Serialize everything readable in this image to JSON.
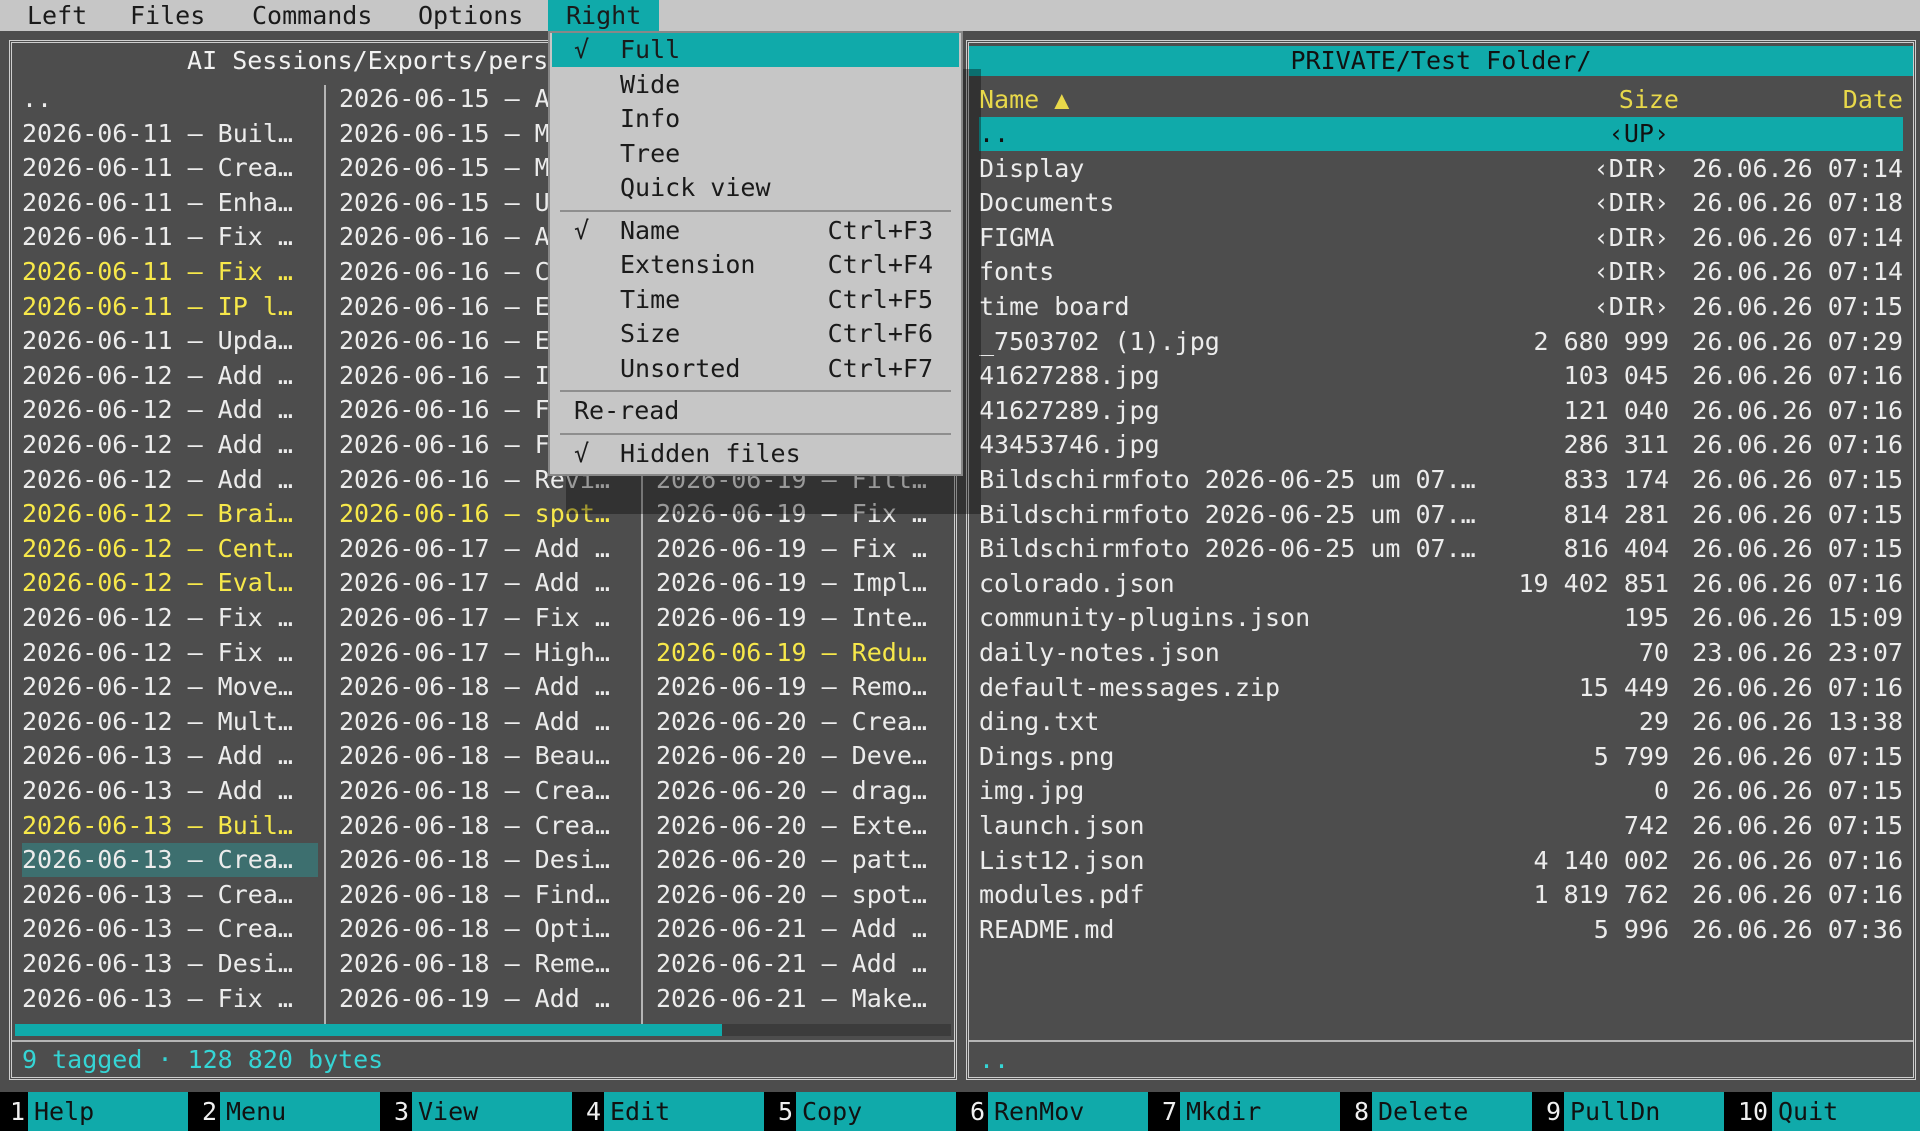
{
  "menubar": {
    "items": [
      "Left",
      "Files",
      "Commands",
      "Options",
      "Right"
    ],
    "active": "Right"
  },
  "left_panel": {
    "title": " AI Sessions/Exports/pers",
    "columns": [
      [
        {
          "text": "..",
          "state": "normal"
        },
        {
          "text": "2026-06-11 – Buil…",
          "state": "normal"
        },
        {
          "text": "2026-06-11 – Crea…",
          "state": "normal"
        },
        {
          "text": "2026-06-11 – Enha…",
          "state": "normal"
        },
        {
          "text": "2026-06-11 – Fix …",
          "state": "normal"
        },
        {
          "text": "2026-06-11 – Fix …",
          "state": "tagged"
        },
        {
          "text": "2026-06-11 – IP l…",
          "state": "tagged"
        },
        {
          "text": "2026-06-11 – Upda…",
          "state": "normal"
        },
        {
          "text": "2026-06-12 – Add …",
          "state": "normal"
        },
        {
          "text": "2026-06-12 – Add …",
          "state": "normal"
        },
        {
          "text": "2026-06-12 – Add …",
          "state": "normal"
        },
        {
          "text": "2026-06-12 – Add …",
          "state": "normal"
        },
        {
          "text": "2026-06-12 – Brai…",
          "state": "tagged"
        },
        {
          "text": "2026-06-12 – Cent…",
          "state": "tagged"
        },
        {
          "text": "2026-06-12 – Eval…",
          "state": "tagged"
        },
        {
          "text": "2026-06-12 – Fix …",
          "state": "normal"
        },
        {
          "text": "2026-06-12 – Fix …",
          "state": "normal"
        },
        {
          "text": "2026-06-12 – Move…",
          "state": "normal"
        },
        {
          "text": "2026-06-12 – Mult…",
          "state": "normal"
        },
        {
          "text": "2026-06-13 – Add …",
          "state": "normal"
        },
        {
          "text": "2026-06-13 – Add …",
          "state": "normal"
        },
        {
          "text": "2026-06-13 – Buil…",
          "state": "tagged"
        },
        {
          "text": "2026-06-13 – Crea…",
          "state": "cursor"
        },
        {
          "text": "2026-06-13 – Crea…",
          "state": "normal"
        },
        {
          "text": "2026-06-13 – Crea…",
          "state": "normal"
        },
        {
          "text": "2026-06-13 – Desi…",
          "state": "normal"
        },
        {
          "text": "2026-06-13 – Fix …",
          "state": "normal"
        }
      ],
      [
        {
          "text": "2026-06-15 – A",
          "state": "normal"
        },
        {
          "text": "2026-06-15 – M",
          "state": "normal"
        },
        {
          "text": "2026-06-15 – M",
          "state": "normal"
        },
        {
          "text": "2026-06-15 – U",
          "state": "normal"
        },
        {
          "text": "2026-06-16 – A",
          "state": "normal"
        },
        {
          "text": "2026-06-16 – C",
          "state": "normal"
        },
        {
          "text": "2026-06-16 – E",
          "state": "normal"
        },
        {
          "text": "2026-06-16 – E",
          "state": "normal"
        },
        {
          "text": "2026-06-16 – I",
          "state": "normal"
        },
        {
          "text": "2026-06-16 – F",
          "state": "normal"
        },
        {
          "text": "2026-06-16 – F",
          "state": "normal"
        },
        {
          "text": "2026-06-16 – Revi…",
          "state": "normal"
        },
        {
          "text": "2026-06-16 – spot…",
          "state": "tagged"
        },
        {
          "text": "2026-06-17 – Add …",
          "state": "normal"
        },
        {
          "text": "2026-06-17 – Add …",
          "state": "normal"
        },
        {
          "text": "2026-06-17 – Fix …",
          "state": "normal"
        },
        {
          "text": "2026-06-17 – High…",
          "state": "normal"
        },
        {
          "text": "2026-06-18 – Add …",
          "state": "normal"
        },
        {
          "text": "2026-06-18 – Add …",
          "state": "normal"
        },
        {
          "text": "2026-06-18 – Beau…",
          "state": "normal"
        },
        {
          "text": "2026-06-18 – Crea…",
          "state": "normal"
        },
        {
          "text": "2026-06-18 – Crea…",
          "state": "normal"
        },
        {
          "text": "2026-06-18 – Desi…",
          "state": "normal"
        },
        {
          "text": "2026-06-18 – Find…",
          "state": "normal"
        },
        {
          "text": "2026-06-18 – Opti…",
          "state": "normal"
        },
        {
          "text": "2026-06-18 – Reme…",
          "state": "normal"
        },
        {
          "text": "2026-06-19 – Add …",
          "state": "normal"
        }
      ],
      [
        {
          "text": "",
          "state": "normal"
        },
        {
          "text": "",
          "state": "normal"
        },
        {
          "text": "",
          "state": "normal"
        },
        {
          "text": "",
          "state": "normal"
        },
        {
          "text": "",
          "state": "normal"
        },
        {
          "text": "",
          "state": "normal"
        },
        {
          "text": "",
          "state": "normal"
        },
        {
          "text": "",
          "state": "normal"
        },
        {
          "text": "",
          "state": "normal"
        },
        {
          "text": "",
          "state": "normal"
        },
        {
          "text": "",
          "state": "normal"
        },
        {
          "text": "2026-06-19 – Filt…",
          "state": "normal"
        },
        {
          "text": "2026-06-19 – Fix …",
          "state": "normal"
        },
        {
          "text": "2026-06-19 – Fix …",
          "state": "normal"
        },
        {
          "text": "2026-06-19 – Impl…",
          "state": "normal"
        },
        {
          "text": "2026-06-19 – Inte…",
          "state": "normal"
        },
        {
          "text": "2026-06-19 – Redu…",
          "state": "tagged"
        },
        {
          "text": "2026-06-19 – Remo…",
          "state": "normal"
        },
        {
          "text": "2026-06-20 – Crea…",
          "state": "normal"
        },
        {
          "text": "2026-06-20 – Deve…",
          "state": "normal"
        },
        {
          "text": "2026-06-20 – drag…",
          "state": "normal"
        },
        {
          "text": "2026-06-20 – Exte…",
          "state": "normal"
        },
        {
          "text": "2026-06-20 – patt…",
          "state": "normal"
        },
        {
          "text": "2026-06-20 – spot…",
          "state": "normal"
        },
        {
          "text": "2026-06-21 – Add …",
          "state": "normal"
        },
        {
          "text": "2026-06-21 – Add …",
          "state": "normal"
        },
        {
          "text": "2026-06-21 – Make…",
          "state": "normal"
        }
      ]
    ],
    "status": "9 tagged · 128 820 bytes",
    "scroll_fraction": 0.75
  },
  "right_panel": {
    "title": "PRIVATE/Test Folder/",
    "header": {
      "name": "Name ▲",
      "size": "Size",
      "date": "Date"
    },
    "rows": [
      {
        "name": "..",
        "size": "‹UP›",
        "date": "",
        "up": true
      },
      {
        "name": "Display",
        "size": "‹DIR›",
        "date": "26.06.26 07:14"
      },
      {
        "name": "Documents",
        "size": "‹DIR›",
        "date": "26.06.26 07:18"
      },
      {
        "name": "FIGMA",
        "size": "‹DIR›",
        "date": "26.06.26 07:14"
      },
      {
        "name": "fonts",
        "size": "‹DIR›",
        "date": "26.06.26 07:14"
      },
      {
        "name": "time board",
        "size": "‹DIR›",
        "date": "26.06.26 07:15"
      },
      {
        "name": "_7503702 (1).jpg",
        "size": "2 680 999",
        "date": "26.06.26 07:29"
      },
      {
        "name": "41627288.jpg",
        "size": "103 045",
        "date": "26.06.26 07:16"
      },
      {
        "name": "41627289.jpg",
        "size": "121 040",
        "date": "26.06.26 07:16"
      },
      {
        "name": "43453746.jpg",
        "size": "286 311",
        "date": "26.06.26 07:16"
      },
      {
        "name": "Bildschirmfoto 2026-06-25 um 07.…",
        "size": "833 174",
        "date": "26.06.26 07:15"
      },
      {
        "name": "Bildschirmfoto 2026-06-25 um 07.…",
        "size": "814 281",
        "date": "26.06.26 07:15"
      },
      {
        "name": "Bildschirmfoto 2026-06-25 um 07.…",
        "size": "816 404",
        "date": "26.06.26 07:15"
      },
      {
        "name": "colorado.json",
        "size": "19 402 851",
        "date": "26.06.26 07:16"
      },
      {
        "name": "community-plugins.json",
        "size": "195",
        "date": "26.06.26 15:09"
      },
      {
        "name": "daily-notes.json",
        "size": "70",
        "date": "23.06.26 23:07"
      },
      {
        "name": "default-messages.zip",
        "size": "15 449",
        "date": "26.06.26 07:16"
      },
      {
        "name": "ding.txt",
        "size": "29",
        "date": "26.06.26 13:38"
      },
      {
        "name": "Dings.png",
        "size": "5 799",
        "date": "26.06.26 07:15"
      },
      {
        "name": "img.jpg",
        "size": "0",
        "date": "26.06.26 07:15"
      },
      {
        "name": "launch.json",
        "size": "742",
        "date": "26.06.26 07:15"
      },
      {
        "name": "List12.json",
        "size": "4 140 002",
        "date": "26.06.26 07:16"
      },
      {
        "name": "modules.pdf",
        "size": "1 819 762",
        "date": "26.06.26 07:16"
      },
      {
        "name": "README.md",
        "size": "5 996",
        "date": "26.06.26 07:36"
      }
    ],
    "status": ".."
  },
  "dropdown": {
    "groups": [
      [
        {
          "label": "Full",
          "checked": true,
          "shortcut": "",
          "active": true
        },
        {
          "label": "Wide",
          "checked": false,
          "shortcut": ""
        },
        {
          "label": "Info",
          "checked": false,
          "shortcut": ""
        },
        {
          "label": "Tree",
          "checked": false,
          "shortcut": ""
        },
        {
          "label": "Quick view",
          "checked": false,
          "shortcut": ""
        }
      ],
      [
        {
          "label": "Name",
          "checked": true,
          "shortcut": "Ctrl+F3"
        },
        {
          "label": "Extension",
          "checked": false,
          "shortcut": "Ctrl+F4"
        },
        {
          "label": "Time",
          "checked": false,
          "shortcut": "Ctrl+F5"
        },
        {
          "label": "Size",
          "checked": false,
          "shortcut": "Ctrl+F6"
        },
        {
          "label": "Unsorted",
          "checked": false,
          "shortcut": "Ctrl+F7"
        }
      ],
      [
        {
          "label": "Re-read",
          "checked": false,
          "shortcut": "",
          "nocheck": true
        }
      ],
      [
        {
          "label": "Hidden files",
          "checked": true,
          "shortcut": ""
        }
      ]
    ],
    "check_glyph": "√"
  },
  "fkeys": [
    {
      "num": "1",
      "label": "Help"
    },
    {
      "num": "2",
      "label": "Menu"
    },
    {
      "num": "3",
      "label": "View"
    },
    {
      "num": "4",
      "label": "Edit"
    },
    {
      "num": "5",
      "label": "Copy"
    },
    {
      "num": "6",
      "label": "RenMov"
    },
    {
      "num": "7",
      "label": "Mkdir"
    },
    {
      "num": "8",
      "label": "Delete"
    },
    {
      "num": "9",
      "label": "PullDn"
    },
    {
      "num": "10",
      "label": "Quit"
    }
  ],
  "colors": {
    "accent": "#10aaaa",
    "tagged": "#f7e84a",
    "background": "#4d4d4d",
    "menu": "#c6c6c6"
  }
}
